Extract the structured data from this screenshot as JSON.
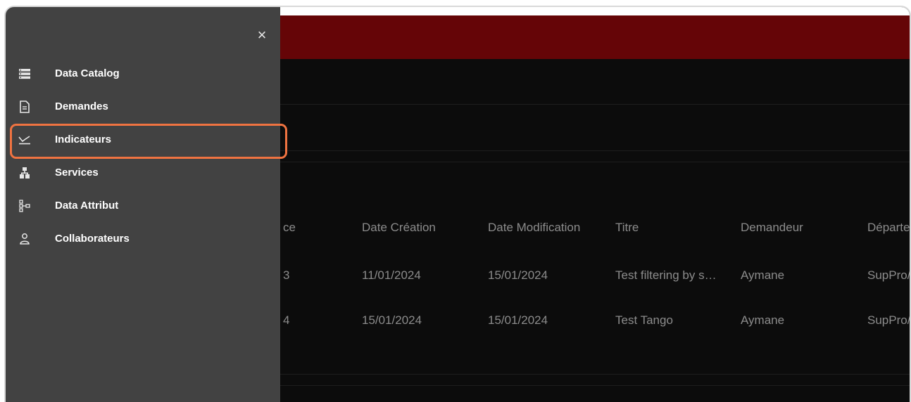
{
  "drawer": {
    "close_label": "×",
    "items": [
      {
        "label": "Data Catalog",
        "icon": "list-icon"
      },
      {
        "label": "Demandes",
        "icon": "document-icon"
      },
      {
        "label": "Indicateurs",
        "icon": "chart-line-icon"
      },
      {
        "label": "Services",
        "icon": "hierarchy-icon"
      },
      {
        "label": "Data Attribut",
        "icon": "tree-icon"
      },
      {
        "label": "Collaborateurs",
        "icon": "person-icon"
      }
    ],
    "highlighted_item": "Indicateurs",
    "highlight_color": "#ef7341"
  },
  "header": {
    "bar_color": "#650507"
  },
  "table": {
    "columns": [
      "ce",
      "Date Création",
      "Date Modification",
      "Titre",
      "Demandeur",
      "Départe"
    ],
    "rows": [
      [
        "3",
        "11/01/2024",
        "15/01/2024",
        "Test filtering by s…",
        "Aymane",
        "SupPro/"
      ],
      [
        "4",
        "15/01/2024",
        "15/01/2024",
        "Test Tango",
        "Aymane",
        "SupPro/"
      ]
    ]
  }
}
